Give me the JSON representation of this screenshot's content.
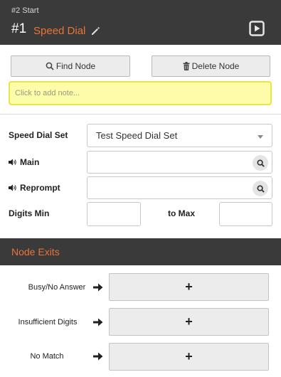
{
  "header": {
    "breadcrumb": "#2 Start",
    "node_number": "#1",
    "node_title": "Speed Dial"
  },
  "toolbar": {
    "find_label": "Find Node",
    "delete_label": "Delete Node"
  },
  "note": {
    "placeholder": "Click to add note..."
  },
  "form": {
    "speed_dial_set_label": "Speed Dial Set",
    "speed_dial_set_value": "Test Speed Dial Set",
    "main_label": "Main",
    "main_value": "",
    "reprompt_label": "Reprompt",
    "reprompt_value": "",
    "digits_min_label": "Digits Min",
    "digits_min_value": "",
    "to_max_label": "to Max",
    "to_max_value": ""
  },
  "exits": {
    "title": "Node Exits",
    "items": [
      {
        "label": "Busy/No Answer",
        "button": "+"
      },
      {
        "label": "Insufficient Digits",
        "button": "+"
      },
      {
        "label": "No Match",
        "button": "+"
      }
    ]
  },
  "colors": {
    "header_bg": "#3a3a3a",
    "accent": "#e8743b",
    "note_bg": "#fdfca8",
    "note_border": "#ece24a"
  }
}
